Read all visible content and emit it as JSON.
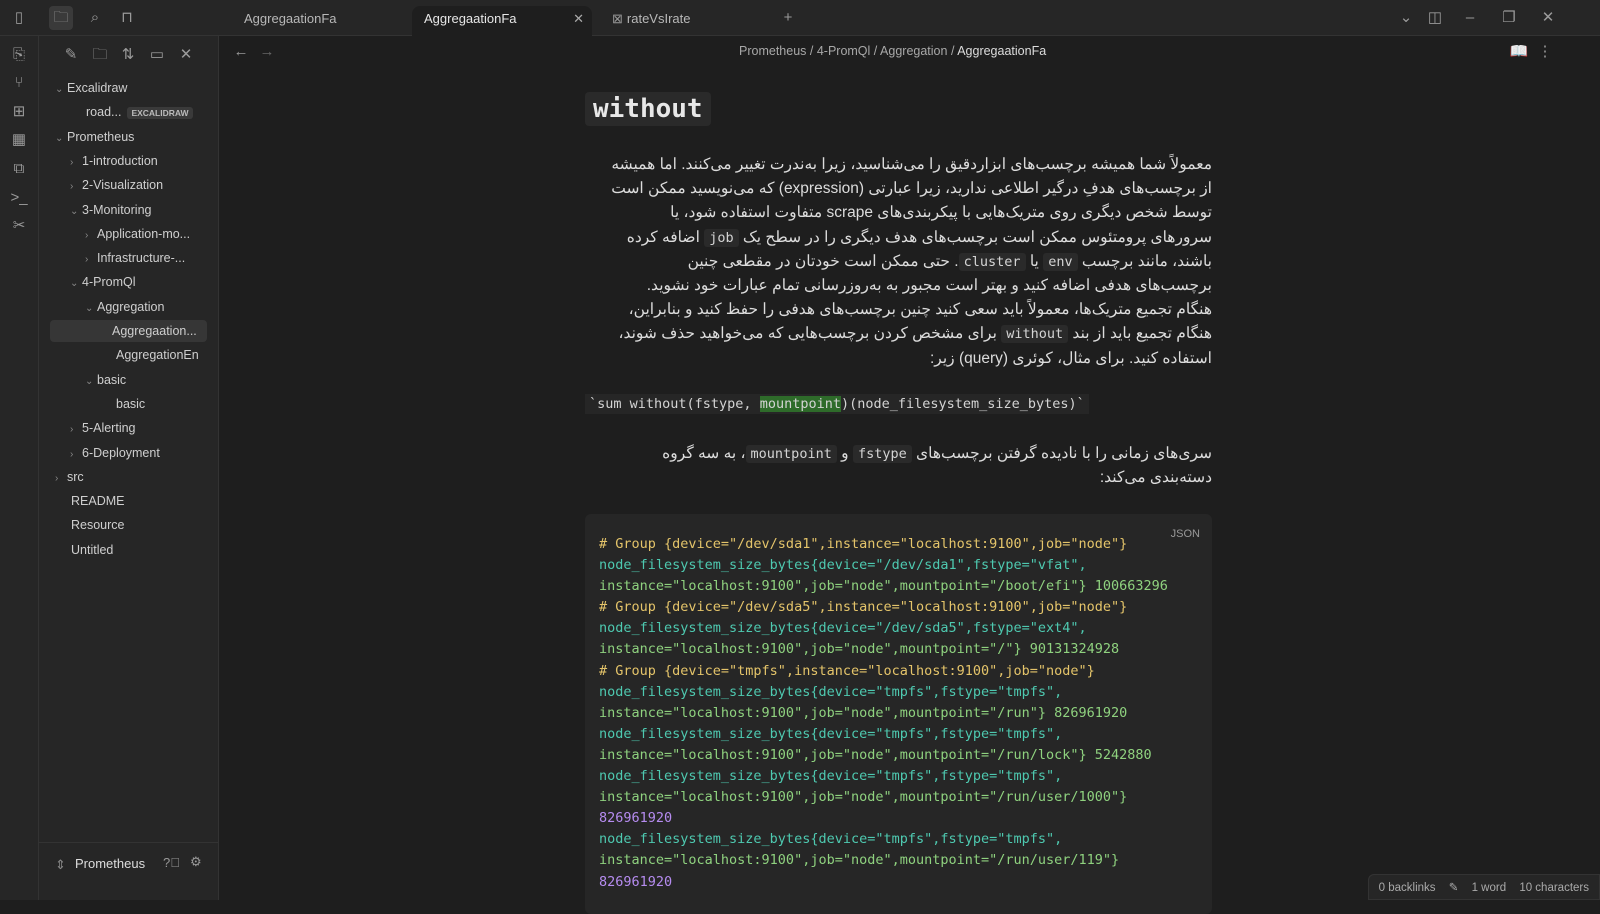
{
  "tabs": [
    {
      "label": "AggregaationFa"
    },
    {
      "label": "AggregaationFa"
    },
    {
      "label": "rateVsIrate"
    }
  ],
  "sidebar": {
    "items": [
      {
        "label": "Excalidraw",
        "chev": "⌄"
      },
      {
        "label": "road...",
        "badge": "EXCALIDRAW"
      },
      {
        "label": "Prometheus",
        "chev": "⌄"
      },
      {
        "label": "1-introduction",
        "chev": "›"
      },
      {
        "label": "2-Visualization",
        "chev": "›"
      },
      {
        "label": "3-Monitoring",
        "chev": "⌄"
      },
      {
        "label": "Application-mo...",
        "chev": "›"
      },
      {
        "label": "Infrastructure-...",
        "chev": "›"
      },
      {
        "label": "4-PromQl",
        "chev": "⌄"
      },
      {
        "label": "Aggregation",
        "chev": "⌄"
      },
      {
        "label": "Aggregaation..."
      },
      {
        "label": "AggregationEn"
      },
      {
        "label": "basic",
        "chev": "⌄"
      },
      {
        "label": "basic"
      },
      {
        "label": "5-Alerting",
        "chev": "›"
      },
      {
        "label": "6-Deployment",
        "chev": "›"
      },
      {
        "label": "src",
        "chev": "›"
      },
      {
        "label": "README"
      },
      {
        "label": "Resource"
      },
      {
        "label": "Untitled"
      }
    ],
    "vault": "Prometheus"
  },
  "breadcrumb": [
    "Prometheus",
    "4-PromQl",
    "Aggregation",
    "AggregaationFa"
  ],
  "doc": {
    "heading": "without",
    "p1a": "معمولاً شما همیشه برچسب‌های ابزاردقیق را می‌شناسید، زیرا به‌ندرت تغییر می‌کنند. اما همیشه از برچسب‌های هدفِ درگیر اطلاعی ندارید، زیرا عبارتی (expression) که می‌نویسید ممکن است توسط شخص دیگری روی متریک‌هایی با پیکربندی‌های scrape متفاوت استفاده شود، یا سرورهای پرومتئوس ممکن است برچسب‌های هدف دیگری را در سطح یک ",
    "p1code1": "job",
    "p1b": " اضافه کرده باشند، مانند برچسب ",
    "p1code2": "env",
    "p1c": " یا ",
    "p1code3": "cluster",
    "p1d": ". حتی ممکن است خودتان در مقطعی چنین برچسب‌های هدفی اضافه کنید و بهتر است مجبور به به‌روزرسانی تمام عبارات خود نشوید. هنگام تجمیع متریک‌ها، معمولاً باید سعی کنید چنین برچسب‌های هدفی را حفظ کنید و بنابراین، هنگام تجمیع باید از بند ",
    "p1code4": "without",
    "p1e": " برای مشخص کردن برچسب‌هایی که می‌خواهید حذف شوند، استفاده کنید. برای مثال، کوئری (query) زیر:",
    "inline_pre": "`sum without(fstype, ",
    "inline_hl": "mountpoint",
    "inline_post": ")(node_filesystem_size_bytes)`",
    "p2a": "سری‌های زمانی را با نادیده گرفتن برچسب‌های ",
    "p2code1": "fstype",
    "p2b": " و ",
    "p2code2": "mountpoint",
    "p2c": "، به سه گروه دسته‌بندی می‌کند:",
    "code_lang": "JSON",
    "code_lines": [
      "# Group {device=\"/dev/sda1\",instance=\"localhost:9100\",job=\"node\"}",
      "node_filesystem_size_bytes{device=\"/dev/sda1\",fstype=\"vfat\",",
      "instance=\"localhost:9100\",job=\"node\",mountpoint=\"/boot/efi\"} 100663296",
      "# Group {device=\"/dev/sda5\",instance=\"localhost:9100\",job=\"node\"}",
      "node_filesystem_size_bytes{device=\"/dev/sda5\",fstype=\"ext4\",",
      "instance=\"localhost:9100\",job=\"node\",mountpoint=\"/\"} 90131324928",
      "# Group {device=\"tmpfs\",instance=\"localhost:9100\",job=\"node\"}",
      "node_filesystem_size_bytes{device=\"tmpfs\",fstype=\"tmpfs\",",
      "instance=\"localhost:9100\",job=\"node\",mountpoint=\"/run\"} 826961920",
      "node_filesystem_size_bytes{device=\"tmpfs\",fstype=\"tmpfs\",",
      "instance=\"localhost:9100\",job=\"node\",mountpoint=\"/run/lock\"} 5242880",
      "node_filesystem_size_bytes{device=\"tmpfs\",fstype=\"tmpfs\",",
      "instance=\"localhost:9100\",job=\"node\",mountpoint=\"/run/user/1000\"}",
      "826961920",
      "node_filesystem_size_bytes{device=\"tmpfs\",fstype=\"tmpfs\",",
      "instance=\"localhost:9100\",job=\"node\",mountpoint=\"/run/user/119\"}",
      "826961920"
    ]
  },
  "status": {
    "backlinks": "0 backlinks",
    "words": "1 word",
    "chars": "10 characters"
  }
}
